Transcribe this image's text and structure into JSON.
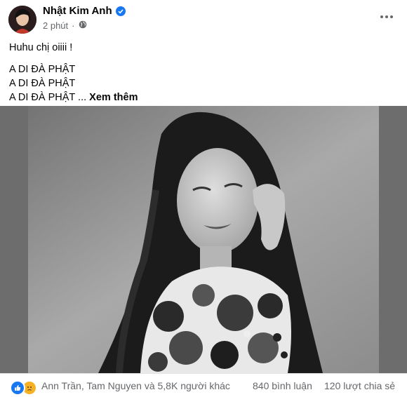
{
  "post": {
    "author": "Nhật Kim Anh",
    "time": "2 phút",
    "lines": [
      "Huhu chị oiiii !",
      "A DI ĐÀ PHẬT",
      "A DI ĐÀ PHẬT",
      "A DI ĐÀ PHẬT ..."
    ],
    "see_more": "Xem thêm"
  },
  "footer": {
    "reactors": "Ann Trần, Tam Nguyen và 5,8K người khác",
    "comments": "840 bình luận",
    "shares": "120 lượt chia sẻ"
  },
  "icons": {
    "verified": "verified-badge-icon",
    "privacy": "globe-icon",
    "more": "more-options-icon",
    "reaction_like": "like-reaction-icon",
    "reaction_sad": "sad-reaction-icon"
  },
  "colors": {
    "accent": "#1877f2",
    "secondary_text": "#65676b",
    "sad": "#f7b125"
  }
}
